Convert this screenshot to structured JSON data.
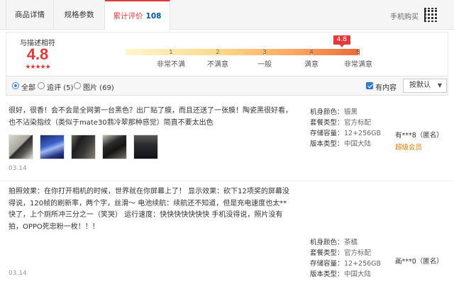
{
  "tabs": [
    {
      "label": "商品详情"
    },
    {
      "label": "规格参数"
    },
    {
      "label": "累计评价",
      "count": "108"
    }
  ],
  "header_right": {
    "buy_label": "手机购买",
    "qr_icon": "qr-code-icon"
  },
  "rating": {
    "label": "与描述相符",
    "score": "4.8",
    "stars": "★★★★★",
    "pointer_value": "4.8",
    "pointer_fraction": 0.96,
    "scale": [
      {
        "num": "1",
        "label": "非常不满"
      },
      {
        "num": "2",
        "label": "不满意"
      },
      {
        "num": "3",
        "label": "一般"
      },
      {
        "num": "4",
        "label": "满意"
      },
      {
        "num": "5",
        "label": "非常满意"
      }
    ]
  },
  "filters": {
    "all": "全部",
    "followup": "追评 (5)",
    "images": "图片 (69)",
    "has_content": "有内容",
    "sort": "按默认",
    "selected": "全部"
  },
  "reviews": [
    {
      "text": "很好，很香！会不会是全网第一台黑色？出厂贴了膜，而且还送了一张膜！陶瓷黑很好看，也不沾染指纹（类似于mate30翡冷翠那种感觉）简直不要太出色",
      "date": "03.14",
      "attrs": [
        {
          "k": "机身颜色：",
          "v": "锻黑"
        },
        {
          "k": "套餐类型：",
          "v": "官方标配"
        },
        {
          "k": "存储容量：",
          "v": "12+256GB"
        },
        {
          "k": "版本类型：",
          "v": "中国大陆"
        }
      ],
      "user": "有***8（匿名）",
      "level": "超级会员"
    },
    {
      "text": "拍照效果：在你打开相机的时候，世界就在你屏幕上了！ 显示效果：砍下12项奖的屏幕没得说，120帧的刷新率，两个字，丝滑～ 电池续航：续航还不知道，但是充电速度也太**快了，上个厕所冲三分之一（笑哭） 运行速度：快快快快快快快 手机没得说，照片没有拍，OPPO死忠粉一枚！！！",
      "date": "03.14",
      "attrs": [
        {
          "k": "机身颜色：",
          "v": "茶橘"
        },
        {
          "k": "套餐类型：",
          "v": "官方标配"
        },
        {
          "k": "存储容量：",
          "v": "12+256GB"
        },
        {
          "k": "版本类型：",
          "v": "中国大陆"
        }
      ],
      "user": "画***0（匿名）"
    }
  ]
}
